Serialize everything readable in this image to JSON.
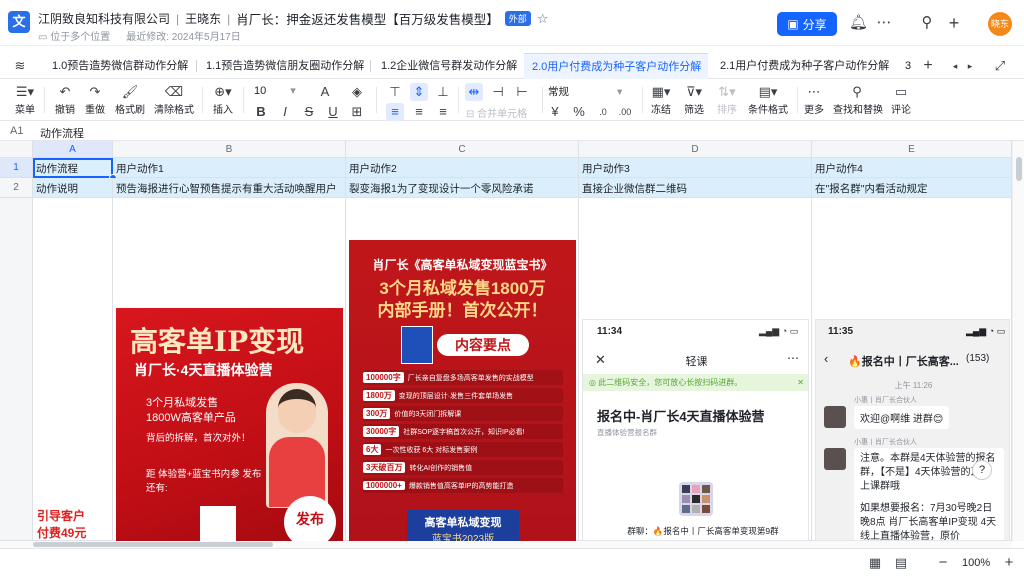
{
  "header": {
    "org": "江阴致良知科技有限公司",
    "owner": "王晓东",
    "doc_title": "肖厂长：押金返还发售模型【百万级发售模型】",
    "external_tag": "外部",
    "location": "位于多个位置",
    "modified": "最近修改: 2024年5月17日",
    "share_label": "分享",
    "avatar_text": "晓东"
  },
  "tabs": [
    "1.0预告造势微信群动作分解",
    "1.1预告造势微信朋友圈动作分解",
    "1.2企业微信号群发动作分解",
    "2.0用户付费成为种子客户动作分解",
    "2.1用户付费成为种子客户动作分解",
    "3"
  ],
  "toolbar": {
    "menu": "菜单",
    "undo": "撤销",
    "redo": "重做",
    "format_painter": "格式刷",
    "clear_format": "清除格式",
    "insert": "插入",
    "font_size": "10",
    "merge": "合并单元格",
    "number_format": "常规",
    "freeze": "冻结",
    "filter": "筛选",
    "sort": "排序",
    "conditional": "条件格式",
    "more": "更多",
    "find_replace": "查找和替换",
    "comment": "评论"
  },
  "formula_bar": {
    "ref": "A1",
    "value": "动作流程"
  },
  "columns": [
    "A",
    "B",
    "C",
    "D",
    "E"
  ],
  "rows": [
    "1",
    "2"
  ],
  "row1": [
    "动作流程",
    "用户动作1",
    "用户动作2",
    "用户动作3",
    "用户动作4"
  ],
  "row2": [
    "动作说明",
    "预告海报进行心智预售提示有重大活动唤醒用户",
    "裂变海报1为了变现设计一个零风险承诺",
    "直接企业微信群二维码",
    "在\"报名群\"内看活动规定"
  ],
  "side_note": [
    "引导客户",
    "付费49元"
  ],
  "poster1": {
    "title": "高客单IP变现",
    "subtitle": "肖厂长·4天直播体验营",
    "lines": [
      "3个月私域发售",
      "1800W高客单产品",
      "背后的拆解，首次对外！"
    ],
    "lines2": [
      "距 体验营+蓝宝书内参 发布",
      "还有:"
    ],
    "badge": "发布"
  },
  "poster2": {
    "head": "肖厂长《高客单私域变现蓝宝书》",
    "big1": "3个月私域发售1800万",
    "big2": "内部手册！首次公开！",
    "section": "内容要点",
    "items": [
      {
        "tag": "100000字",
        "text": "厂长亲自复盘多场高客单发售的实战模型"
      },
      {
        "tag": "1800万",
        "text": "变现的顶层设计·发售三件套单场发售"
      },
      {
        "tag": "300万",
        "text": "价值的3天闭门拆解课"
      },
      {
        "tag": "30000字",
        "text": "社群SOP逐字稿首次公开，知识IP必看!"
      },
      {
        "tag": "6大",
        "text": "一次性收获 6大 对标发售案例"
      },
      {
        "tag": "3天破百万",
        "text": "转化AI创作的销售值"
      },
      {
        "tag": "1000000+",
        "text": "爆款销售值高客单IP的高势能打造"
      }
    ],
    "book_title": "高客单私域变现",
    "book_sub": "蓝宝书2023版"
  },
  "chat1": {
    "time": "11:34",
    "title": "轻课",
    "notice": "此二维码安全，您可放心长按扫码进群。",
    "group_title": "报名中-肖厂长4天直播体验营",
    "group_sub": "直播体验营报名群",
    "group_label": "群聊：🔥报名中丨厂长高客单变现第9群"
  },
  "chat2": {
    "time": "11:35",
    "title": "🔥报名中丨厂长高客...",
    "count": "(153)",
    "msg_time": "上午 11:26",
    "sender": "小惠丨肖厂长合伙人",
    "msg1": "欢迎@啊维 进群😊",
    "msg2": "注意。本群是4天体验营的报名群，【不是】4天体验营的正式上课群哦",
    "msg3": "如果想要报名：7月30号晚2日晚8点 肖厂长高客单IP变现 4天线上直播体验营，原价"
  },
  "zoom": "100%"
}
